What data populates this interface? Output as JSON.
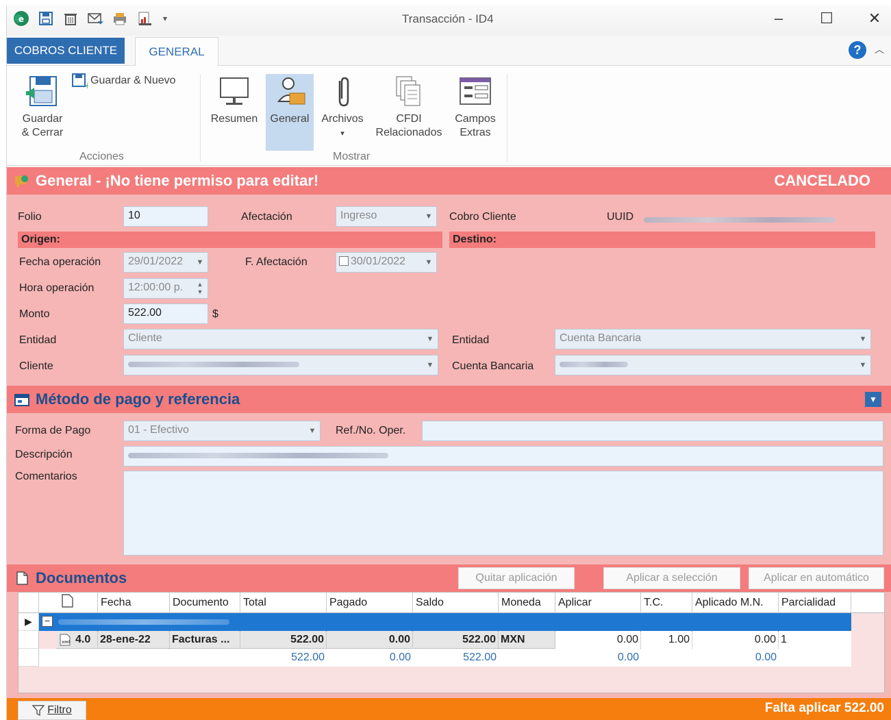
{
  "window": {
    "title": "Transacción - ID4"
  },
  "tabs": {
    "file": "COBROS CLIENTE",
    "general": "GENERAL"
  },
  "help": "?",
  "ribbon": {
    "guardar_cerrar_1": "Guardar",
    "guardar_cerrar_2": "& Cerrar",
    "guardar_nuevo": "Guardar & Nuevo",
    "acciones": "Acciones",
    "resumen": "Resumen",
    "general": "General",
    "archivos": "Archivos",
    "cfdi_1": "CFDI",
    "cfdi_2": "Relacionados",
    "campos_1": "Campos",
    "campos_2": "Extras",
    "mostrar": "Mostrar"
  },
  "general_section": {
    "title": "General - ¡No tiene permiso para editar!",
    "status": "CANCELADO",
    "folio_label": "Folio",
    "folio": "10",
    "afectacion_label": "Afectación",
    "afectacion": "Ingreso",
    "cobro_cliente_label": "Cobro Cliente",
    "uuid_label": "UUID",
    "origen": "Origen:",
    "destino": "Destino:",
    "fecha_operacion_label": "Fecha operación",
    "fecha_operacion": "29/01/2022",
    "f_afectacion_label": "F. Afectación",
    "f_afectacion": "30/01/2022",
    "hora_operacion_label": "Hora operación",
    "hora_operacion": "12:00:00 p.",
    "monto_label": "Monto",
    "monto": "522.00",
    "currency_symbol": "$",
    "entidad_label": "Entidad",
    "entidad_origen": "Cliente",
    "cliente_label": "Cliente",
    "entidad_destino_label": "Entidad",
    "entidad_destino": "Cuenta Bancaria",
    "cuenta_bancaria_label": "Cuenta Bancaria"
  },
  "metodo_section": {
    "title": "Método de pago y referencia",
    "forma_pago_label": "Forma de Pago",
    "forma_pago": "01 - Efectivo",
    "ref_label": "Ref./No. Oper.",
    "descripcion_label": "Descripción",
    "comentarios_label": "Comentarios"
  },
  "documentos_section": {
    "title": "Documentos",
    "quitar": "Quitar aplicación",
    "aplicar_seleccion": "Aplicar a selección",
    "aplicar_auto": "Aplicar en automático"
  },
  "grid": {
    "columns": [
      "Fecha",
      "Documento",
      "Total",
      "Pagado",
      "Saldo",
      "Moneda",
      "Aplicar",
      "T.C.",
      "Aplicado M.N.",
      "Parcialidad"
    ],
    "row": {
      "version": "4.0",
      "fecha": "28-ene-22",
      "documento": "Facturas ...",
      "total": "522.00",
      "pagado": "0.00",
      "saldo": "522.00",
      "moneda": "MXN",
      "aplicar": "0.00",
      "tc": "1.00",
      "aplicado_mn": "0.00",
      "parcialidad": "1"
    },
    "summary": {
      "total": "522.00",
      "pagado": "0.00",
      "saldo": "522.00",
      "aplicar": "0.00",
      "aplicado_mn": "0.00"
    }
  },
  "footer": {
    "filter": "Filtro",
    "falta": "Falta aplicar 522.00"
  },
  "colors": {
    "header_pink": "#f47c7c",
    "body_pink": "#f6b6b6",
    "accent_blue": "#2f6db1",
    "footer_orange": "#f57e0e",
    "row_select": "#1e78d2"
  }
}
